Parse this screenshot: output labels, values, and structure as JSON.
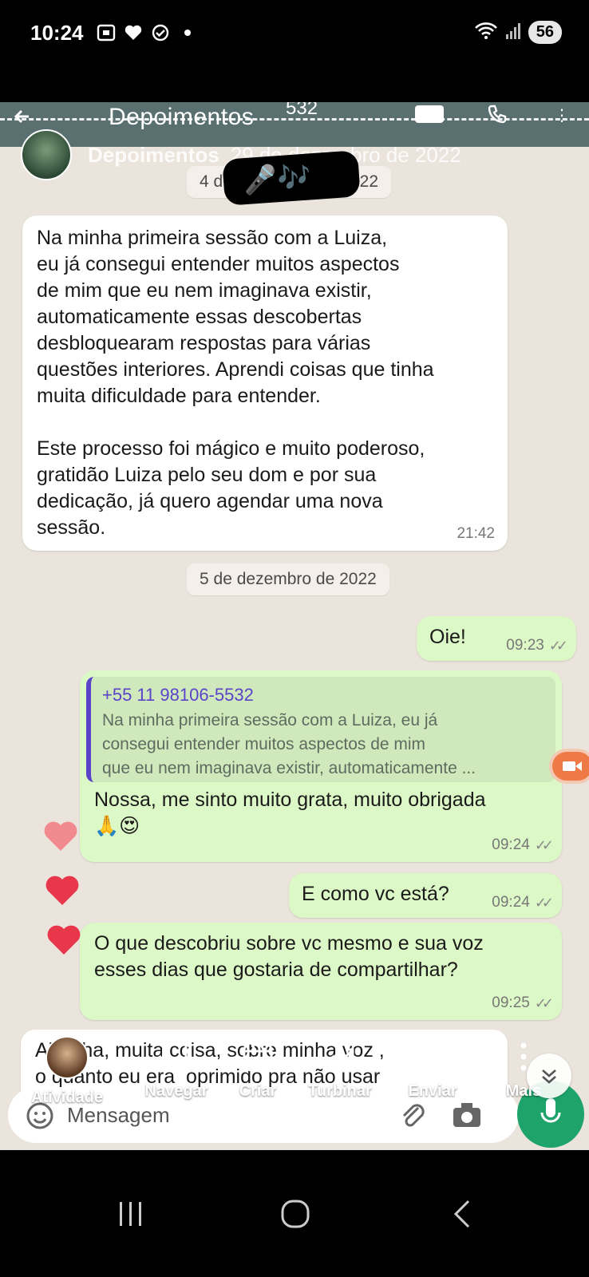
{
  "status_bar": {
    "time": "10:24",
    "battery": "56",
    "icons": [
      "screenshot-icon",
      "heart-icon",
      "check-circle-icon",
      "dot-icon",
      "wifi-icon",
      "signal-icon"
    ]
  },
  "chat_header": {
    "title": "Depoimentos",
    "partial_number": "532"
  },
  "story": {
    "user_name": "Depoimentos",
    "date": "29 de dezembro de 2022",
    "sticker_emojis": "🎤🎶😍"
  },
  "date_pills": {
    "first": "4 d",
    "first_suffix": "22",
    "second": "5 de dezembro de 2022"
  },
  "messages": [
    {
      "direction": "in",
      "text": "Na minha primeira sessão com a Luiza,\neu já consegui entender muitos aspectos\nde mim que eu nem imaginava existir,\nautomaticamente essas descobertas\ndesbloquearam respostas para várias\nquestões interiores. Aprendi coisas que tinha\nmuita dificuldade para entender.\n\nEste processo foi mágico e muito poderoso,\ngratidão Luiza pelo seu dom e por sua\ndedicação, já quero agendar uma nova\nsessão.",
      "time": "21:42"
    },
    {
      "direction": "out",
      "text": "Oie!",
      "time": "09:23"
    },
    {
      "direction": "out",
      "quote_author": "+55 11 98106-5532",
      "quote_text": "Na minha primeira sessão com a Luiza, eu já\nconsegui entender muitos aspectos de mim\nque eu nem imaginava existir, automaticamente ...",
      "text": "Nossa, me sinto muito grata, muito obrigada\n🙏😍",
      "time": "09:24"
    },
    {
      "direction": "out",
      "text": "E como vc está?",
      "time": "09:24"
    },
    {
      "direction": "out",
      "text": "O que descobriu sobre vc mesmo e sua voz\nesses dias que gostaria de compartilhar?",
      "time": "09:25"
    },
    {
      "direction": "in",
      "text": "Ahhhha, muita coisa, sobre minha voz ,\no quanto eu era  oprimido pra não usar"
    }
  ],
  "composer": {
    "placeholder": "Mensagem"
  },
  "toolbar": {
    "items": [
      {
        "label": "Atividade",
        "icon": "avatar-icon"
      },
      {
        "label": "Navegar",
        "icon": "phone-icon"
      },
      {
        "label": "Criar",
        "icon": "create-icon"
      },
      {
        "label": "Turbinar",
        "icon": "trend-icon"
      },
      {
        "label": "Enviar",
        "icon": "send-icon"
      },
      {
        "label": "Mais",
        "icon": "more-icon"
      }
    ]
  },
  "colors": {
    "incoming_bubble": "#ffffff",
    "outgoing_bubble": "#dcf8c6",
    "quote_accent": "#5b43c9",
    "heart": "#e8374a",
    "mic": "#1ea36b"
  }
}
